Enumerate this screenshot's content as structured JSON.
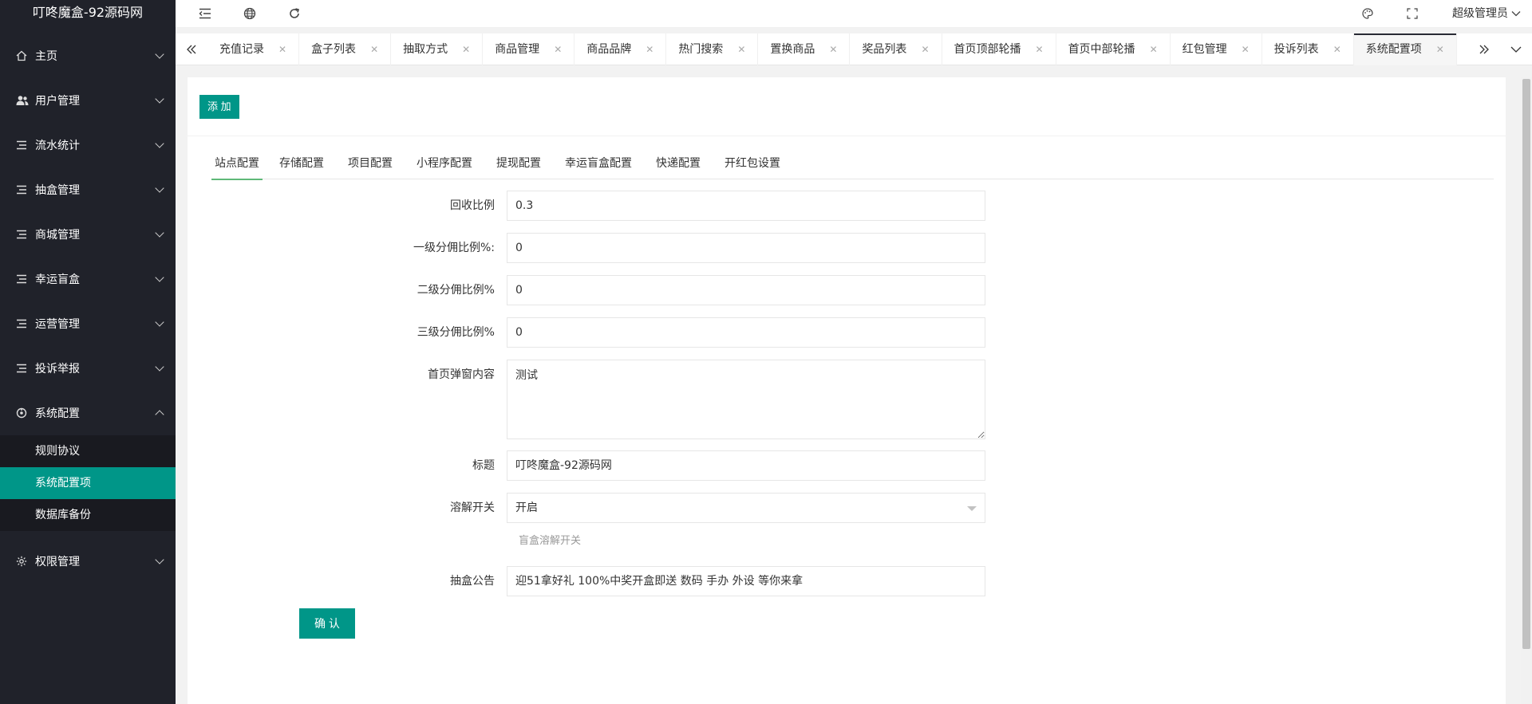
{
  "sidebar": {
    "logo": "叮咚魔盒-92源码网",
    "items": [
      {
        "label": "主页",
        "icon": "home-icon"
      },
      {
        "label": "用户管理",
        "icon": "users-icon"
      },
      {
        "label": "流水统计",
        "icon": "list-icon"
      },
      {
        "label": "抽盒管理",
        "icon": "list-icon"
      },
      {
        "label": "商城管理",
        "icon": "list-icon"
      },
      {
        "label": "幸运盲盒",
        "icon": "list-icon"
      },
      {
        "label": "运营管理",
        "icon": "list-icon"
      },
      {
        "label": "投诉举报",
        "icon": "list-icon"
      },
      {
        "label": "系统配置",
        "icon": "settings-icon"
      },
      {
        "label": "权限管理",
        "icon": "gear-icon"
      }
    ],
    "subitems": [
      {
        "label": "规则协议"
      },
      {
        "label": "系统配置项"
      },
      {
        "label": "数据库备份"
      }
    ]
  },
  "header": {
    "user": "超级管理员"
  },
  "tabs": [
    {
      "label": "充值记录"
    },
    {
      "label": "盒子列表"
    },
    {
      "label": "抽取方式"
    },
    {
      "label": "商品管理"
    },
    {
      "label": "商品品牌"
    },
    {
      "label": "热门搜索"
    },
    {
      "label": "置换商品"
    },
    {
      "label": "奖品列表"
    },
    {
      "label": "首页顶部轮播"
    },
    {
      "label": "首页中部轮播"
    },
    {
      "label": "红包管理"
    },
    {
      "label": "投诉列表"
    },
    {
      "label": "系统配置项"
    }
  ],
  "content": {
    "add_button": "添 加",
    "subtabs": [
      {
        "label": "站点配置"
      },
      {
        "label": "存储配置"
      },
      {
        "label": "项目配置"
      },
      {
        "label": "小程序配置"
      },
      {
        "label": "提现配置"
      },
      {
        "label": "幸运盲盒配置"
      },
      {
        "label": "快递配置"
      },
      {
        "label": "开红包设置"
      }
    ],
    "form": {
      "recycle_ratio": {
        "label": "回收比例",
        "value": "0.3"
      },
      "level1": {
        "label": "一级分佣比例%:",
        "value": "0"
      },
      "level2": {
        "label": "二级分佣比例%",
        "value": "0"
      },
      "level3": {
        "label": "三级分佣比例%",
        "value": "0"
      },
      "popup": {
        "label": "首页弹窗内容",
        "value": "测试"
      },
      "title": {
        "label": "标题",
        "value": "叮咚魔盒-92源码网"
      },
      "dissolve": {
        "label": "溶解开关",
        "value": "开启",
        "hint": "盲盒溶解开关"
      },
      "notice": {
        "label": "抽盒公告",
        "value": "迎51拿好礼 100%中奖开盒即送 数码 手办 外设 等你来拿"
      }
    },
    "confirm_button": "确 认"
  },
  "colors": {
    "sidebar_bg": "#20222a",
    "accent": "#009688",
    "tab_underline": "#5FB878"
  }
}
